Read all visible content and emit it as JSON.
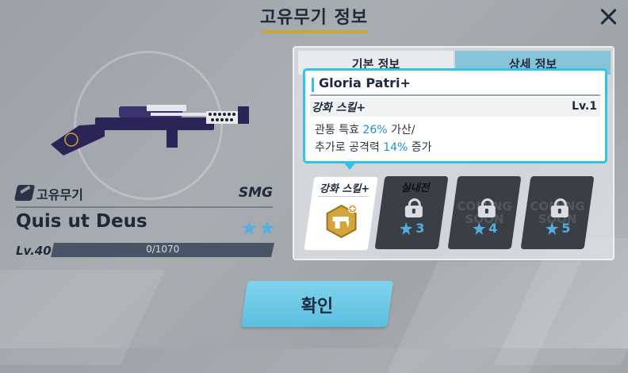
{
  "header": {
    "title": "고유무기 정보"
  },
  "weapon": {
    "type_label": "고유무기",
    "class": "SMG",
    "name": "Quis ut Deus",
    "stars": 2,
    "level": "Lv.40",
    "exp_text": "0/1070",
    "exp_progress": 0
  },
  "tabs": [
    {
      "label": "기본 정보",
      "active": true
    },
    {
      "label": "상세 정보",
      "active": false
    }
  ],
  "tooltip": {
    "title": "Gloria Patri+",
    "skill_label": "강화 스킬+",
    "skill_level": "Lv.1",
    "line1_a": "관통 특효 ",
    "line1_b": "26%",
    "line1_c": " 가산/",
    "line2_a": "추가로 공격력 ",
    "line2_b": "14%",
    "line2_c": " 증가"
  },
  "cards": [
    {
      "title": "강화 스킬+",
      "locked": false
    },
    {
      "title": "실내전",
      "locked": true,
      "star": "3"
    },
    {
      "title": "",
      "locked": true,
      "coming": "COMING SOON",
      "star": "4"
    },
    {
      "title": "",
      "locked": true,
      "coming": "COMING SOON",
      "star": "5"
    }
  ],
  "confirm": {
    "label": "확인"
  },
  "colors": {
    "accent": "#2ec4e6",
    "gold": "#c9a932",
    "star": "#55aee0",
    "confirm": "#6ccae6"
  }
}
